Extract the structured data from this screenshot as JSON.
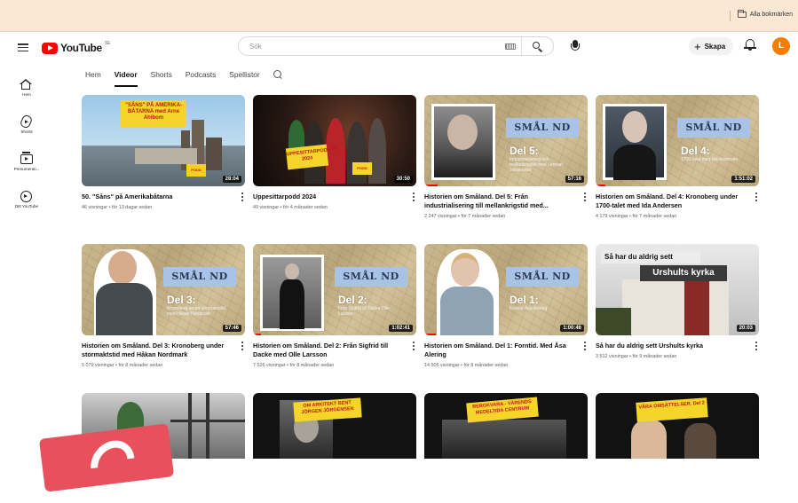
{
  "bookmarks": {
    "all_bookmarks": "Alla bokmärken"
  },
  "header": {
    "logo_text": "YouTube",
    "logo_region": "SE",
    "search_placeholder": "Sök",
    "create_label": "Skapa",
    "avatar_letter": "L",
    "colors": {
      "brand": "#ff0000",
      "avatar": "#f57c00"
    }
  },
  "sidebar": {
    "items": [
      {
        "label": "Hem",
        "icon": "home-icon"
      },
      {
        "label": "Shorts",
        "icon": "shorts-icon"
      },
      {
        "label": "Prenumerati...",
        "icon": "subscriptions-icon"
      },
      {
        "label": "Ditt YouTube",
        "icon": "you-icon"
      }
    ]
  },
  "tabs": [
    {
      "label": "Hem",
      "active": false
    },
    {
      "label": "Videor",
      "active": true
    },
    {
      "label": "Shorts",
      "active": false
    },
    {
      "label": "Podcasts",
      "active": false
    },
    {
      "label": "Spellistor",
      "active": false
    }
  ],
  "videos": [
    {
      "title": "50. \"Såns\" på Amerikabåtarna",
      "meta": "46 visningar • för 13 dagar sedan",
      "duration": "28:04",
      "thumb_text": "\"SÅNS\" PÅ AMERIKA-BÅTARNA med Arne Ahlbom"
    },
    {
      "title": "Uppesittarpodd 2024",
      "meta": "49 visningar • för 4 månader sedan",
      "duration": "30:50",
      "thumb_text": "UPPESITTARPODDEN 2024"
    },
    {
      "title": "Historien om Småland. Del 5: Från industrialisering till mellankrigstid med...",
      "meta": "2 247 visningar • för 7 månader sedan",
      "duration": "57:16",
      "thumb_del": "Del 5:",
      "thumb_sub": "Industrialisering och mellankrigstid med Lennart Johansson",
      "progress": 0.06
    },
    {
      "title": "Historien om Småland. Del 4: Kronoberg under 1700-talet med Ida Andersen",
      "meta": "4 179 visningar • för 7 månader sedan",
      "duration": "1:51:02",
      "thumb_del": "Del 4:",
      "thumb_sub": "1700-talet med Ida Andersen",
      "progress": 0.04
    },
    {
      "title": "Historien om Småland. Del 3: Kronoberg under stormaktstid med Håkan Nordmark",
      "meta": "5 079 visningar • för 8 månader sedan",
      "duration": "57:46",
      "thumb_del": "Del 3:",
      "thumb_sub": "Kronoberg under stormaktstid med Håkan Nordmark"
    },
    {
      "title": "Historien om Småland. Del 2: Från Sigfrid till Dacke med Olle Larsson",
      "meta": "7 526 visningar • för 8 månader sedan",
      "duration": "1:02:41",
      "thumb_del": "Del 2:",
      "thumb_sub": "Från Sigfrid till Dacke Olle Larsson",
      "progress": 0.05
    },
    {
      "title": "Historien om Småland. Del 1: Forntid. Med Åsa Alering",
      "meta": "14 505 visningar • för 8 månader sedan",
      "duration": "1:00:46",
      "thumb_del": "Del 1:",
      "thumb_sub": "Forntid Åsa Alering",
      "progress": 0.06
    },
    {
      "title": "Så har du aldrig sett Urshults kyrka",
      "meta": "3 512 visningar • för 9 månader sedan",
      "duration": "20:03",
      "thumb_text": "Så har du aldrig sett",
      "thumb_text2": "Urshults kyrka"
    },
    {
      "title": "",
      "meta": "",
      "duration": "",
      "thumb_text": ""
    },
    {
      "title": "",
      "meta": "",
      "duration": "",
      "thumb_text": "OM ARKITEKT BENT JÖRGEN JÖRGENSEN"
    },
    {
      "title": "",
      "meta": "",
      "duration": "",
      "thumb_text": "BERGKVARA - VÄRENDS MEDELTIDA CENTRUM"
    },
    {
      "title": "",
      "meta": "",
      "duration": "",
      "thumb_text": "VÅRA OMSÄTTELSER. Del 2"
    }
  ]
}
